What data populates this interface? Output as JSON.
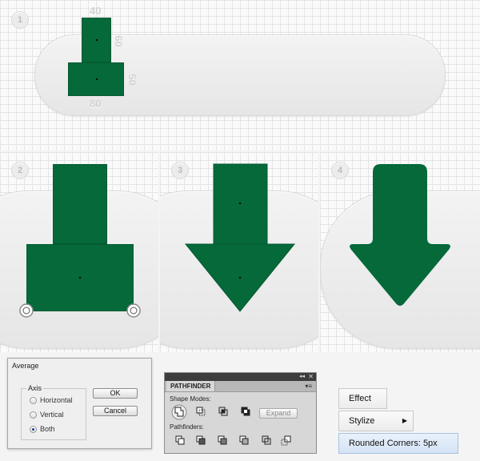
{
  "steps": [
    "1",
    "2",
    "3",
    "4"
  ],
  "dimensions": {
    "top_width": "40",
    "top_height": "60",
    "bottom_height": "50",
    "bottom_width": "80"
  },
  "average_dialog": {
    "title": "Average",
    "axis_label": "Axis",
    "options": [
      "Horizontal",
      "Vertical",
      "Both"
    ],
    "selected": "Both",
    "ok_label": "OK",
    "cancel_label": "Cancel"
  },
  "pathfinder": {
    "tab_label": "PATHFINDER",
    "shape_modes_label": "Shape Modes:",
    "expand_label": "Expand",
    "pathfinders_label": "Pathfinders:",
    "shape_mode_icons": [
      "unite-icon",
      "minus-front-icon",
      "intersect-icon",
      "exclude-icon"
    ],
    "pathfinder_icons": [
      "divide-icon",
      "trim-icon",
      "merge-icon",
      "crop-icon",
      "outline-icon",
      "minus-back-icon"
    ]
  },
  "effect_menu": {
    "effect": "Effect",
    "stylize": "Stylize",
    "rounded_corners": "Rounded Corners: 5px"
  },
  "colors": {
    "shape_green": "#05693a",
    "grid_line": "#e4e4e4"
  }
}
